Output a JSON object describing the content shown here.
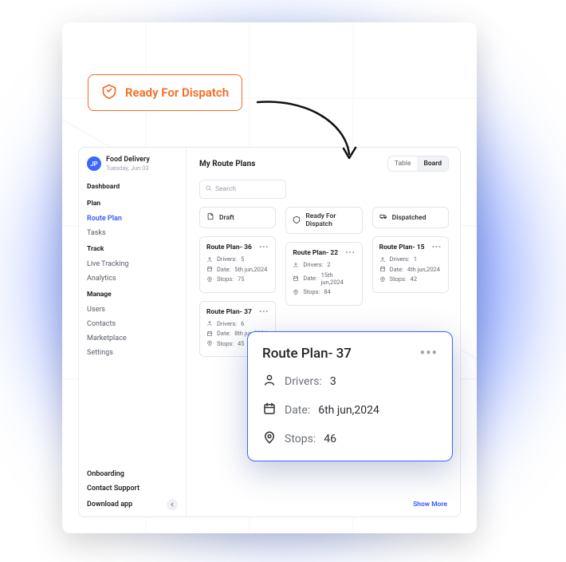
{
  "top_badge": {
    "label": "Ready For Dispatch"
  },
  "project": {
    "avatar_initials": "JP",
    "name": "Food Delivery",
    "date": "Tuesday, Jun 03"
  },
  "sidebar": {
    "dashboard_label": "Dashboard",
    "sections": [
      {
        "label": "Plan",
        "items": [
          {
            "label": "Route Plan",
            "active": true
          },
          {
            "label": "Tasks"
          }
        ]
      },
      {
        "label": "Track",
        "items": [
          {
            "label": "Live Tracking"
          },
          {
            "label": "Analytics"
          }
        ]
      },
      {
        "label": "Manage",
        "items": [
          {
            "label": "Users"
          },
          {
            "label": "Contacts"
          },
          {
            "label": "Marketplace"
          },
          {
            "label": "Settings"
          }
        ]
      }
    ],
    "footer": {
      "onboarding": "Onboarding",
      "support": "Contact Support",
      "download": "Download app"
    }
  },
  "main": {
    "title": "My Route Plans",
    "view_toggle": {
      "table": "Table",
      "board": "Board",
      "active": "Board"
    },
    "search_placeholder": "Search",
    "show_more": "Show More",
    "columns": [
      {
        "icon": "file-icon",
        "label": "Draft",
        "cards": [
          {
            "title": "Route Plan- 36",
            "drivers_label": "Drivers:",
            "drivers": "5",
            "date_label": "Date:",
            "date": "5th jun,2024",
            "stops_label": "Stops:",
            "stops": "75"
          },
          {
            "title": "Route Plan- 37",
            "drivers_label": "Drivers:",
            "drivers": "6",
            "date_label": "Date:",
            "date": "8th jun,2024",
            "stops_label": "Stops:",
            "stops": "45"
          }
        ]
      },
      {
        "icon": "dispatch-icon",
        "label": "Ready For Dispatch",
        "cards": [
          {
            "title": "Route Plan- 22",
            "drivers_label": "Drivers:",
            "drivers": "2",
            "date_label": "Date:",
            "date": "15th jun,2024",
            "stops_label": "Stops:",
            "stops": "84"
          }
        ]
      },
      {
        "icon": "truck-icon",
        "label": "Dispatched",
        "cards": [
          {
            "title": "Route Plan- 15",
            "drivers_label": "Drivers:",
            "drivers": "1",
            "date_label": "Date:",
            "date": "4th jun,2024",
            "stops_label": "Stops:",
            "stops": "42"
          }
        ]
      }
    ]
  },
  "popup": {
    "title": "Route Plan- 37",
    "drivers_label": "Drivers:",
    "drivers": "3",
    "date_label": "Date:",
    "date": "6th jun,2024",
    "stops_label": "Stops:",
    "stops": "46"
  }
}
